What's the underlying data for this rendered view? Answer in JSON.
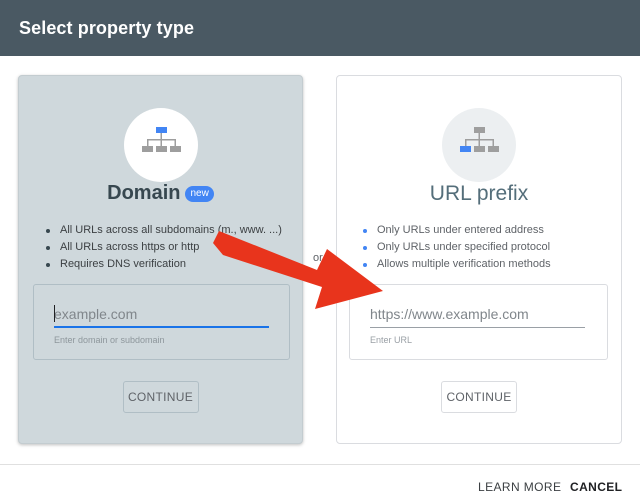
{
  "header": {
    "title": "Select property type"
  },
  "domain_card": {
    "icon": "site-hierarchy-icon",
    "title": "Domain",
    "badge": "new",
    "features": [
      "All URLs across all subdomains (m., www. ...)",
      "All URLs across https or http",
      "Requires DNS verification"
    ],
    "input": {
      "value": "",
      "placeholder": "example.com",
      "helper": "Enter domain or subdomain"
    },
    "continue_label": "CONTINUE"
  },
  "separator": {
    "label": "or"
  },
  "url_card": {
    "icon": "url-prefix-hierarchy-icon",
    "title": "URL prefix",
    "features": [
      "Only URLs under entered address",
      "Only URLs under specified protocol",
      "Allows multiple verification methods"
    ],
    "input": {
      "value": "",
      "placeholder": "https://www.example.com",
      "helper": "Enter URL"
    },
    "continue_label": "CONTINUE"
  },
  "footer": {
    "learn_more_label": "LEARN MORE",
    "cancel_label": "CANCEL"
  },
  "colors": {
    "header_bg": "#4a5963",
    "accent": "#4285f4",
    "arrow": "#e8341c",
    "domain_card_bg": "#cfd8dc"
  }
}
